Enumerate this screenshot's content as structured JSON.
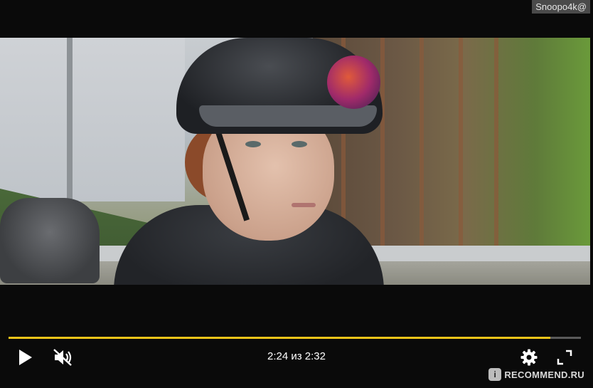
{
  "watermark_top": "Snoopo4k@",
  "player": {
    "time_current": "2:24",
    "time_separator": "из",
    "time_total": "2:32",
    "progress_fraction": 0.947,
    "accent_color": "#f0c419",
    "icons": {
      "play": "play-icon",
      "mute": "muted-speaker-icon",
      "settings": "gear-icon",
      "fullscreen": "fullscreen-icon"
    }
  },
  "watermark_bottom": {
    "badge": "i",
    "text": "RECOMMEND.RU"
  }
}
